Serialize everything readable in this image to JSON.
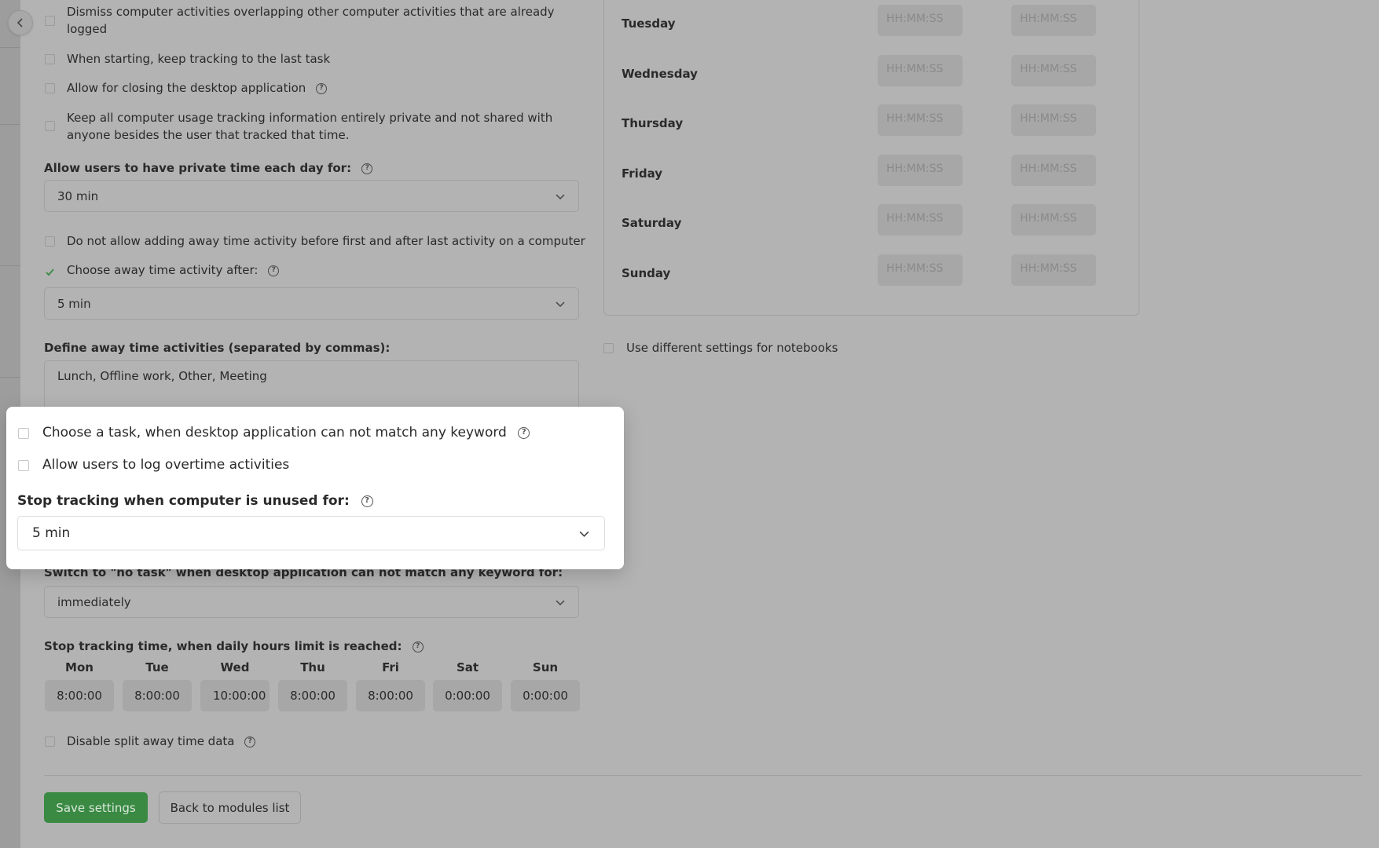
{
  "nav": {
    "back_icon": "chevron-left-icon"
  },
  "options": {
    "dismiss_overlapping": "Dismiss computer activities overlapping other computer activities that are already logged",
    "keep_last_task": "When starting, keep tracking to the last task",
    "allow_closing": "Allow for closing the desktop application",
    "keep_private": "Keep all computer usage tracking information entirely private and not shared with anyone besides the user that tracked that time.",
    "no_away_outside": "Do not allow adding away time activity before first and after last activity on a computer",
    "choose_away_after": "Choose away time activity after:",
    "disable_split": "Disable split away time data",
    "use_notebooks": "Use different settings for notebooks"
  },
  "private_time": {
    "label": "Allow users to have private time each day for:",
    "value": "30 min"
  },
  "away_after": {
    "value": "5 min"
  },
  "away_activities": {
    "label": "Define away time activities (separated by commas):",
    "value": "Lunch, Offline work, Other, Meeting"
  },
  "popup": {
    "choose_task": "Choose a task, when desktop application can not match any keyword",
    "allow_overtime": "Allow users to log overtime activities",
    "stop_unused_label": "Stop tracking when computer is unused for:",
    "stop_unused_value": "5 min"
  },
  "no_task_switch": {
    "label": "Switch to \"no task\" when desktop application can not match any keyword for:",
    "value": "immediately"
  },
  "daily_limit": {
    "label": "Stop tracking time, when daily hours limit is reached:",
    "days": [
      {
        "day": "Mon",
        "value": "8:00:00"
      },
      {
        "day": "Tue",
        "value": "8:00:00"
      },
      {
        "day": "Wed",
        "value": "10:00:00"
      },
      {
        "day": "Thu",
        "value": "8:00:00"
      },
      {
        "day": "Fri",
        "value": "8:00:00"
      },
      {
        "day": "Sat",
        "value": "0:00:00"
      },
      {
        "day": "Sun",
        "value": "0:00:00"
      }
    ]
  },
  "schedule": {
    "placeholder": "HH:MM:SS",
    "days": [
      "Tuesday",
      "Wednesday",
      "Thursday",
      "Friday",
      "Saturday",
      "Sunday"
    ]
  },
  "actions": {
    "save": "Save settings",
    "back": "Back to modules list"
  },
  "colors": {
    "accent_green": "#3a8a43",
    "overlay": "#b3b3b3"
  }
}
